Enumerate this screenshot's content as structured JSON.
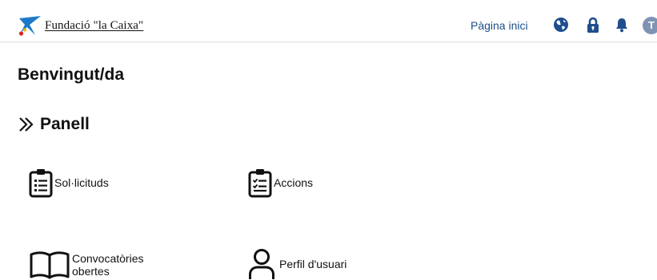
{
  "header": {
    "brand_name": "Fundació \"la Caixa\"",
    "home_link": "Pàgina inici",
    "avatar_initial": "T",
    "brand_colors": {
      "star_blue": "#1d7ac9",
      "dot_red": "#e2231a",
      "dot_yellow": "#f7b500",
      "link": "#1a4f8b",
      "icons": "#1f4e8c",
      "avatar": "#7f93b3"
    }
  },
  "icons": {
    "header": [
      "globe-icon",
      "lock-icon",
      "bell-icon"
    ],
    "section": "double-chevron-right-icon",
    "tiles": [
      "clipboard-list-icon",
      "clipboard-check-icon",
      "open-book-icon",
      "user-icon"
    ]
  },
  "main": {
    "welcome": "Benvingut/da",
    "section_title": "Panell",
    "tiles": [
      {
        "label": "Sol·licituds"
      },
      {
        "label": "Accions"
      },
      {
        "label": "Convocatòries obertes"
      },
      {
        "label": "Perfil d'usuari"
      }
    ]
  }
}
